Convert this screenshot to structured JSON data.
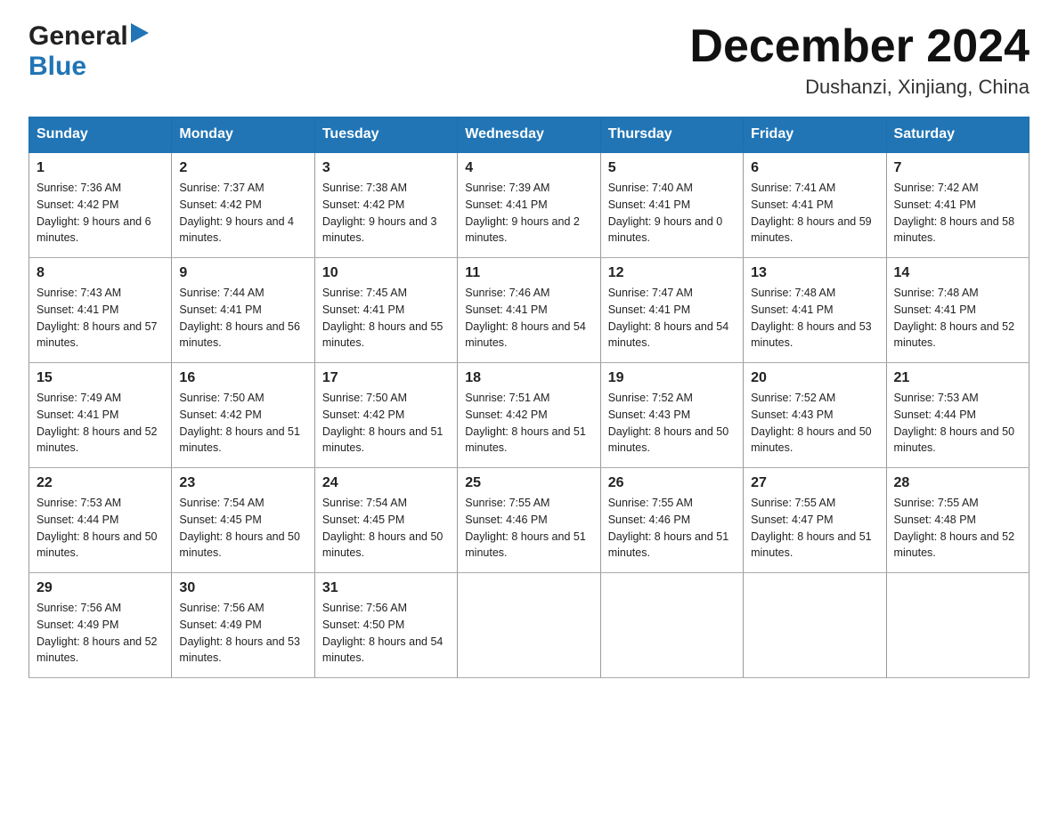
{
  "logo": {
    "general": "General",
    "blue": "Blue",
    "triangle_char": "▶"
  },
  "title": "December 2024",
  "location": "Dushanzi, Xinjiang, China",
  "weekdays": [
    "Sunday",
    "Monday",
    "Tuesday",
    "Wednesday",
    "Thursday",
    "Friday",
    "Saturday"
  ],
  "weeks": [
    [
      {
        "day": "1",
        "sunrise": "7:36 AM",
        "sunset": "4:42 PM",
        "daylight": "9 hours and 6 minutes."
      },
      {
        "day": "2",
        "sunrise": "7:37 AM",
        "sunset": "4:42 PM",
        "daylight": "9 hours and 4 minutes."
      },
      {
        "day": "3",
        "sunrise": "7:38 AM",
        "sunset": "4:42 PM",
        "daylight": "9 hours and 3 minutes."
      },
      {
        "day": "4",
        "sunrise": "7:39 AM",
        "sunset": "4:41 PM",
        "daylight": "9 hours and 2 minutes."
      },
      {
        "day": "5",
        "sunrise": "7:40 AM",
        "sunset": "4:41 PM",
        "daylight": "9 hours and 0 minutes."
      },
      {
        "day": "6",
        "sunrise": "7:41 AM",
        "sunset": "4:41 PM",
        "daylight": "8 hours and 59 minutes."
      },
      {
        "day": "7",
        "sunrise": "7:42 AM",
        "sunset": "4:41 PM",
        "daylight": "8 hours and 58 minutes."
      }
    ],
    [
      {
        "day": "8",
        "sunrise": "7:43 AM",
        "sunset": "4:41 PM",
        "daylight": "8 hours and 57 minutes."
      },
      {
        "day": "9",
        "sunrise": "7:44 AM",
        "sunset": "4:41 PM",
        "daylight": "8 hours and 56 minutes."
      },
      {
        "day": "10",
        "sunrise": "7:45 AM",
        "sunset": "4:41 PM",
        "daylight": "8 hours and 55 minutes."
      },
      {
        "day": "11",
        "sunrise": "7:46 AM",
        "sunset": "4:41 PM",
        "daylight": "8 hours and 54 minutes."
      },
      {
        "day": "12",
        "sunrise": "7:47 AM",
        "sunset": "4:41 PM",
        "daylight": "8 hours and 54 minutes."
      },
      {
        "day": "13",
        "sunrise": "7:48 AM",
        "sunset": "4:41 PM",
        "daylight": "8 hours and 53 minutes."
      },
      {
        "day": "14",
        "sunrise": "7:48 AM",
        "sunset": "4:41 PM",
        "daylight": "8 hours and 52 minutes."
      }
    ],
    [
      {
        "day": "15",
        "sunrise": "7:49 AM",
        "sunset": "4:41 PM",
        "daylight": "8 hours and 52 minutes."
      },
      {
        "day": "16",
        "sunrise": "7:50 AM",
        "sunset": "4:42 PM",
        "daylight": "8 hours and 51 minutes."
      },
      {
        "day": "17",
        "sunrise": "7:50 AM",
        "sunset": "4:42 PM",
        "daylight": "8 hours and 51 minutes."
      },
      {
        "day": "18",
        "sunrise": "7:51 AM",
        "sunset": "4:42 PM",
        "daylight": "8 hours and 51 minutes."
      },
      {
        "day": "19",
        "sunrise": "7:52 AM",
        "sunset": "4:43 PM",
        "daylight": "8 hours and 50 minutes."
      },
      {
        "day": "20",
        "sunrise": "7:52 AM",
        "sunset": "4:43 PM",
        "daylight": "8 hours and 50 minutes."
      },
      {
        "day": "21",
        "sunrise": "7:53 AM",
        "sunset": "4:44 PM",
        "daylight": "8 hours and 50 minutes."
      }
    ],
    [
      {
        "day": "22",
        "sunrise": "7:53 AM",
        "sunset": "4:44 PM",
        "daylight": "8 hours and 50 minutes."
      },
      {
        "day": "23",
        "sunrise": "7:54 AM",
        "sunset": "4:45 PM",
        "daylight": "8 hours and 50 minutes."
      },
      {
        "day": "24",
        "sunrise": "7:54 AM",
        "sunset": "4:45 PM",
        "daylight": "8 hours and 50 minutes."
      },
      {
        "day": "25",
        "sunrise": "7:55 AM",
        "sunset": "4:46 PM",
        "daylight": "8 hours and 51 minutes."
      },
      {
        "day": "26",
        "sunrise": "7:55 AM",
        "sunset": "4:46 PM",
        "daylight": "8 hours and 51 minutes."
      },
      {
        "day": "27",
        "sunrise": "7:55 AM",
        "sunset": "4:47 PM",
        "daylight": "8 hours and 51 minutes."
      },
      {
        "day": "28",
        "sunrise": "7:55 AM",
        "sunset": "4:48 PM",
        "daylight": "8 hours and 52 minutes."
      }
    ],
    [
      {
        "day": "29",
        "sunrise": "7:56 AM",
        "sunset": "4:49 PM",
        "daylight": "8 hours and 52 minutes."
      },
      {
        "day": "30",
        "sunrise": "7:56 AM",
        "sunset": "4:49 PM",
        "daylight": "8 hours and 53 minutes."
      },
      {
        "day": "31",
        "sunrise": "7:56 AM",
        "sunset": "4:50 PM",
        "daylight": "8 hours and 54 minutes."
      },
      null,
      null,
      null,
      null
    ]
  ],
  "labels": {
    "sunrise": "Sunrise:",
    "sunset": "Sunset:",
    "daylight": "Daylight:"
  }
}
